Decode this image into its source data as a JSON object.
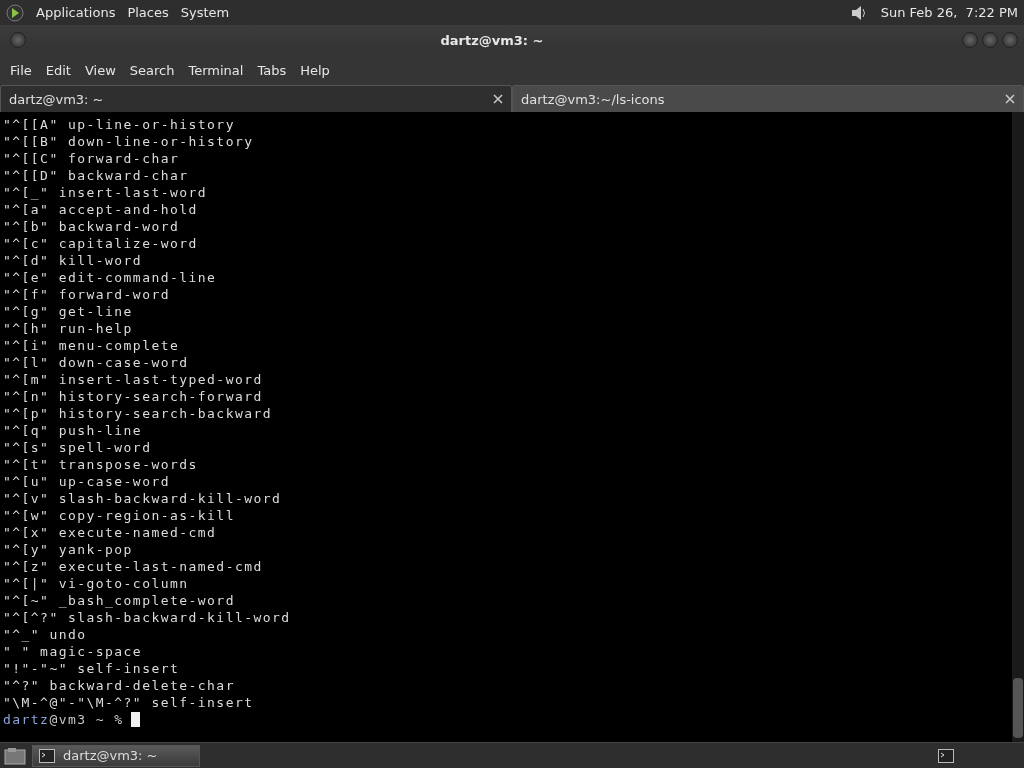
{
  "top_panel": {
    "menus": [
      "Applications",
      "Places",
      "System"
    ],
    "clock": "Sun Feb 26,  7:22 PM"
  },
  "window": {
    "title": "dartz@vm3: ~"
  },
  "menubar": [
    "File",
    "Edit",
    "View",
    "Search",
    "Terminal",
    "Tabs",
    "Help"
  ],
  "tabs": [
    {
      "label": "dartz@vm3: ~",
      "selected": true
    },
    {
      "label": "dartz@vm3:~/ls-icons",
      "selected": false
    }
  ],
  "terminal": {
    "lines": [
      "\"^[[A\" up-line-or-history",
      "\"^[[B\" down-line-or-history",
      "\"^[[C\" forward-char",
      "\"^[[D\" backward-char",
      "\"^[_\" insert-last-word",
      "\"^[a\" accept-and-hold",
      "\"^[b\" backward-word",
      "\"^[c\" capitalize-word",
      "\"^[d\" kill-word",
      "\"^[e\" edit-command-line",
      "\"^[f\" forward-word",
      "\"^[g\" get-line",
      "\"^[h\" run-help",
      "\"^[i\" menu-complete",
      "\"^[l\" down-case-word",
      "\"^[m\" insert-last-typed-word",
      "\"^[n\" history-search-forward",
      "\"^[p\" history-search-backward",
      "\"^[q\" push-line",
      "\"^[s\" spell-word",
      "\"^[t\" transpose-words",
      "\"^[u\" up-case-word",
      "\"^[v\" slash-backward-kill-word",
      "\"^[w\" copy-region-as-kill",
      "\"^[x\" execute-named-cmd",
      "\"^[y\" yank-pop",
      "\"^[z\" execute-last-named-cmd",
      "\"^[|\" vi-goto-column",
      "\"^[~\" _bash_complete-word",
      "\"^[^?\" slash-backward-kill-word",
      "\"^_\" undo",
      "\" \" magic-space",
      "\"!\"-\"~\" self-insert",
      "\"^?\" backward-delete-char",
      "\"\\M-^@\"-\"\\M-^?\" self-insert"
    ],
    "prompt": {
      "user": "dartz",
      "rest": "@vm3 ~ %"
    }
  },
  "taskbar": {
    "items": [
      {
        "label": "dartz@vm3: ~",
        "selected": true
      }
    ]
  }
}
